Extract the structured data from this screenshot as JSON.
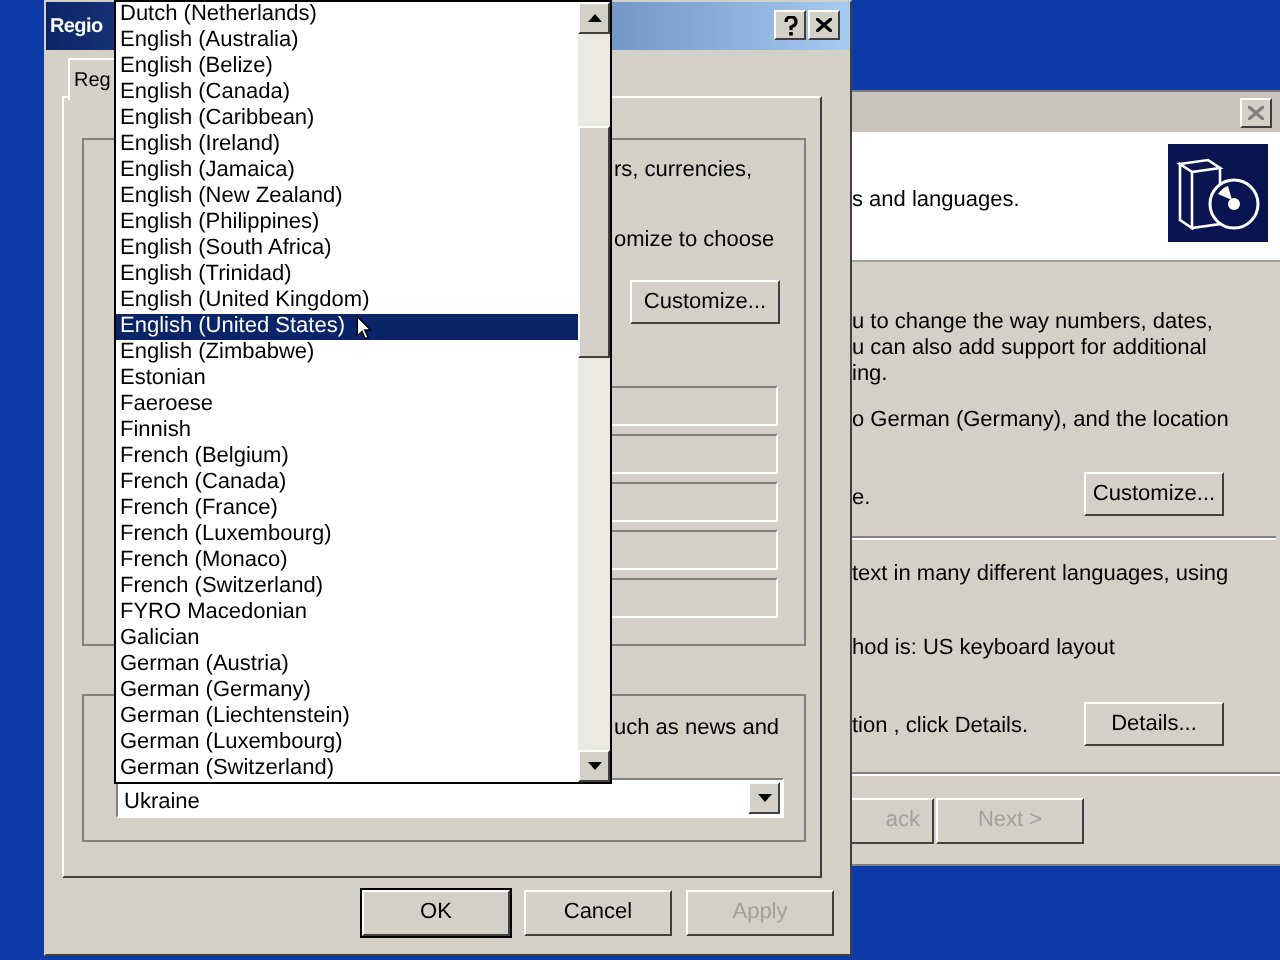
{
  "back_window": {
    "header_text": "s and languages.",
    "lines": [
      "u to change the way numbers, dates,",
      "u can also add support for additional",
      "ing.",
      "o German (Germany), and the location",
      "e.",
      "text in many different languages, using",
      "hod is: US keyboard layout",
      "tion , click Details."
    ],
    "customize_button": "Customize...",
    "details_button": "Details...",
    "nav_buttons": [
      {
        "label": "ack",
        "disabled": true
      },
      {
        "label": "Next >",
        "disabled": true
      }
    ]
  },
  "dialog": {
    "title": "Regio",
    "tab": {
      "label": "Reg",
      "selected": true
    },
    "settings_group": {
      "text_1": "rs, currencies,",
      "text_2": "omize to choose",
      "customize_button": "Customize..."
    },
    "location_group": {
      "text": "uch as news and",
      "location": "Ukraine"
    },
    "buttons": [
      {
        "label": "OK",
        "default": true,
        "disabled": false
      },
      {
        "label": "Cancel",
        "default": false,
        "disabled": false
      },
      {
        "label": "Apply",
        "default": false,
        "disabled": true
      }
    ]
  },
  "dropdown_list": {
    "items": [
      {
        "label": "Dutch (Netherlands)",
        "selected": false
      },
      {
        "label": "English (Australia)",
        "selected": false
      },
      {
        "label": "English (Belize)",
        "selected": false
      },
      {
        "label": "English (Canada)",
        "selected": false
      },
      {
        "label": "English (Caribbean)",
        "selected": false
      },
      {
        "label": "English (Ireland)",
        "selected": false
      },
      {
        "label": "English (Jamaica)",
        "selected": false
      },
      {
        "label": "English (New Zealand)",
        "selected": false
      },
      {
        "label": "English (Philippines)",
        "selected": false
      },
      {
        "label": "English (South Africa)",
        "selected": false
      },
      {
        "label": "English (Trinidad)",
        "selected": false
      },
      {
        "label": "English (United Kingdom)",
        "selected": false
      },
      {
        "label": "English (United States)",
        "selected": true
      },
      {
        "label": "English (Zimbabwe)",
        "selected": false
      },
      {
        "label": "Estonian",
        "selected": false
      },
      {
        "label": "Faeroese",
        "selected": false
      },
      {
        "label": "Finnish",
        "selected": false
      },
      {
        "label": "French (Belgium)",
        "selected": false
      },
      {
        "label": "French (Canada)",
        "selected": false
      },
      {
        "label": "French (France)",
        "selected": false
      },
      {
        "label": "French (Luxembourg)",
        "selected": false
      },
      {
        "label": "French (Monaco)",
        "selected": false
      },
      {
        "label": "French (Switzerland)",
        "selected": false
      },
      {
        "label": "FYRO Macedonian",
        "selected": false
      },
      {
        "label": "Galician",
        "selected": false
      },
      {
        "label": "German (Austria)",
        "selected": false
      },
      {
        "label": "German (Germany)",
        "selected": false
      },
      {
        "label": "German (Liechtenstein)",
        "selected": false
      },
      {
        "label": "German (Luxembourg)",
        "selected": false
      },
      {
        "label": "German (Switzerland)",
        "selected": false
      }
    ]
  }
}
